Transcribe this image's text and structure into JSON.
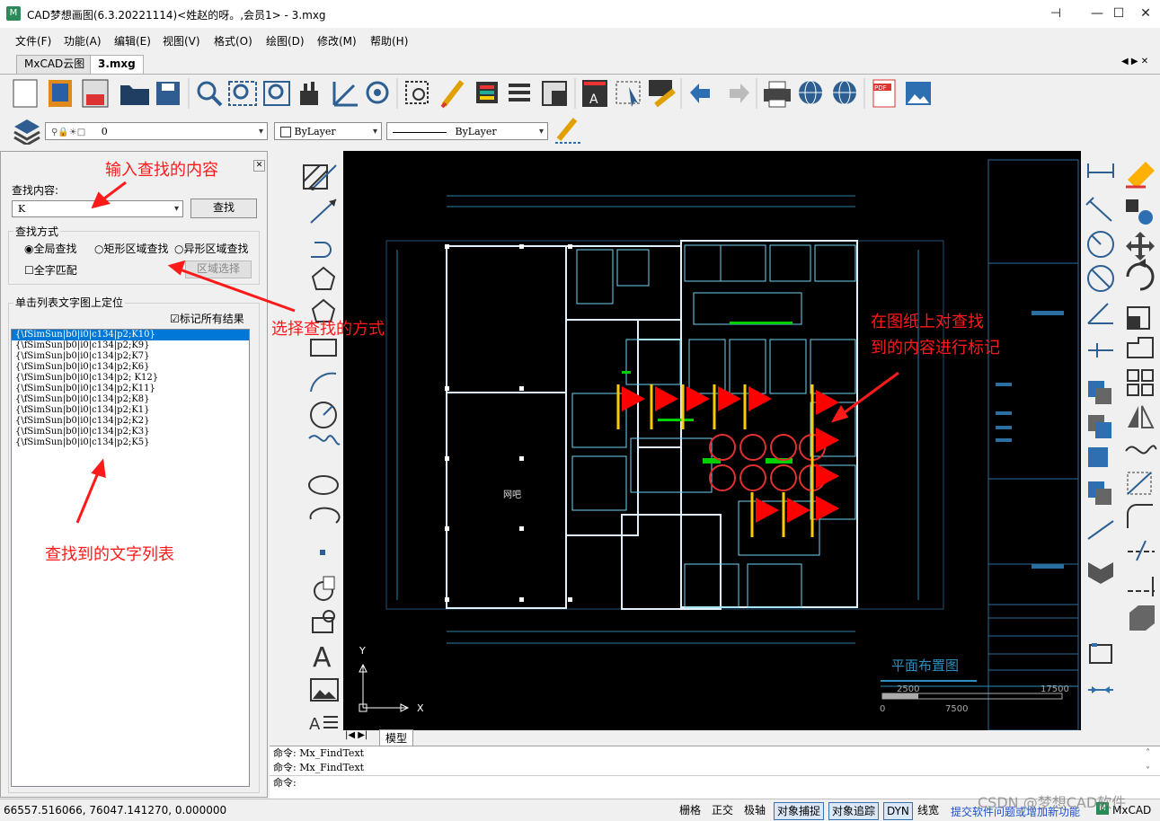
{
  "window": {
    "title": "CAD梦想画图(6.3.20221114)<姓赵的呀。,会员1> - 3.mxg",
    "app_icon": "M",
    "controls": [
      "pin-icon",
      "minimize-icon",
      "maximize-icon",
      "close-icon"
    ]
  },
  "menu": [
    "文件(F)",
    "功能(A)",
    "编辑(E)",
    "视图(V)",
    "格式(O)",
    "绘图(D)",
    "修改(M)",
    "帮助(H)"
  ],
  "tabs": [
    {
      "label": "MxCAD云图",
      "active": false
    },
    {
      "label": "3.mxg",
      "active": true
    }
  ],
  "tab_nav": "◀ ▶ ✕",
  "layer_bar": {
    "layer_value": "0",
    "color_value": "ByLayer",
    "linetype_value": "ByLayer"
  },
  "find_panel": {
    "content_label": "查找内容:",
    "search_value": "K",
    "find_button": "查找",
    "mode_group_label": "查找方式",
    "modes": [
      {
        "label": "全局查找",
        "checked": true
      },
      {
        "label": "矩形区域查找",
        "checked": false
      },
      {
        "label": "异形区域查找",
        "checked": false
      }
    ],
    "whole_word_label": "全字匹配",
    "whole_word_checked": false,
    "region_select_button": "区域选择",
    "locate_group_label": "单击列表文字图上定位",
    "mark_all_label": "标记所有结果",
    "mark_all_checked": true,
    "results": [
      "{\\fSimSun|b0|i0|c134|p2;K10}",
      "{\\fSimSun|b0|i0|c134|p2;K9}",
      "{\\fSimSun|b0|i0|c134|p2;K7}",
      "{\\fSimSun|b0|i0|c134|p2;K6}",
      "{\\fSimSun|b0|i0|c134|p2; K12}",
      "{\\fSimSun|b0|i0|c134|p2;K11}",
      "{\\fSimSun|b0|i0|c134|p2;K8}",
      "{\\fSimSun|b0|i0|c134|p2;K1}",
      "{\\fSimSun|b0|i0|c134|p2;K2}",
      "{\\fSimSun|b0|i0|c134|p2;K3}",
      "{\\fSimSun|b0|i0|c134|p2;K5}"
    ],
    "selected_index": 0
  },
  "annotations": {
    "input_hint": "输入查找的内容",
    "mode_hint": "选择查找的方式",
    "list_hint": "查找到的文字列表",
    "mark_hint_line1": "在图纸上对查找",
    "mark_hint_line2": "到的内容进行标记"
  },
  "drawing": {
    "room_label": "网吧",
    "plan_title": "平面布置图",
    "scale_labels": [
      "0",
      "7500",
      "2500",
      "17500"
    ],
    "y_axis": "Y",
    "x_axis": "X",
    "model_tab": "模型",
    "marker_color": "#ff0000",
    "marker_pole_color": "#ffcc00"
  },
  "command": {
    "lines": [
      "命令:  Mx_FindText",
      "命令:  Mx_FindText",
      "命令:"
    ]
  },
  "status": {
    "coords": "66557.516066,  76047.141270,  0.000000",
    "buttons": [
      {
        "label": "栅格",
        "on": false
      },
      {
        "label": "正交",
        "on": false
      },
      {
        "label": "极轴",
        "on": false
      },
      {
        "label": "对象捕捉",
        "on": true
      },
      {
        "label": "对象追踪",
        "on": true
      },
      {
        "label": "DYN",
        "on": true
      },
      {
        "label": "线宽",
        "on": false
      }
    ],
    "link": "提交软件问题或增加新功能",
    "brand": "MxCAD",
    "watermark": "CSDN @梦想CAD软件"
  }
}
